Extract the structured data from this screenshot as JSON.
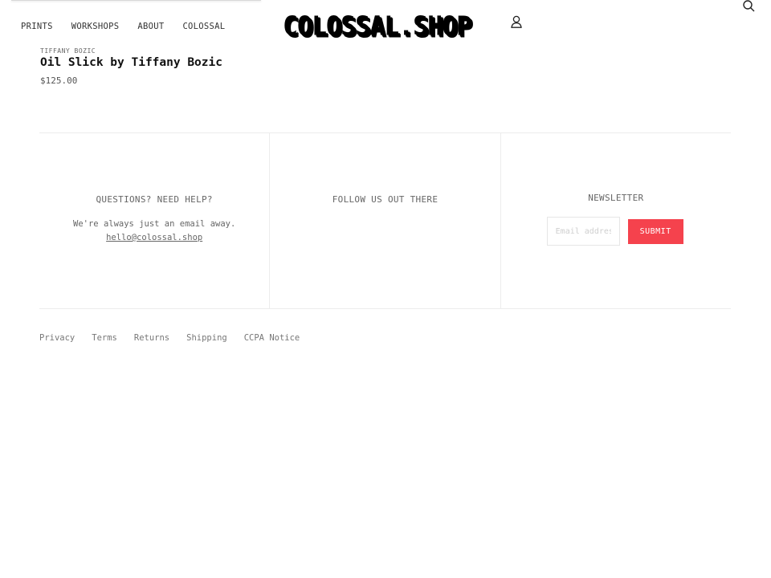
{
  "header": {
    "nav": [
      "PRINTS",
      "WORKSHOPS",
      "ABOUT",
      "COLOSSAL"
    ],
    "logo_text": "COLOSSAL.SHOP",
    "icons": {
      "account": "user-icon",
      "search": "search-icon"
    }
  },
  "product": {
    "vendor": "TIFFANY BOZIC",
    "title": "Oil Slick by Tiffany Bozic",
    "price": "$125.00"
  },
  "footer": {
    "help": {
      "heading": "QUESTIONS? NEED HELP?",
      "message": "We're always just an email away.",
      "email": "hello@colossal.shop"
    },
    "social": {
      "heading": "FOLLOW US OUT THERE"
    },
    "newsletter": {
      "heading": "NEWSLETTER",
      "email_placeholder": "Email address",
      "email_value": "",
      "submit_label": "SUBMIT",
      "submit_color": "#f5424d"
    },
    "legal_links": [
      "Privacy",
      "Terms",
      "Returns",
      "Shipping",
      "CCPA Notice"
    ]
  }
}
